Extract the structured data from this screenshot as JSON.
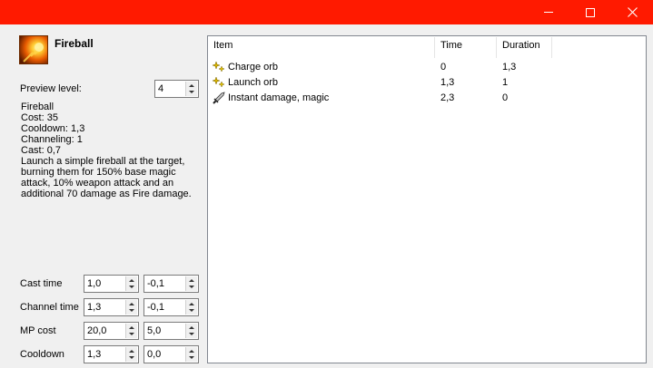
{
  "window": {
    "controls": {
      "minimize": "minimize-icon",
      "maximize": "maximize-icon",
      "close": "close-icon"
    },
    "titlebar_color": "#ff1a00"
  },
  "skill": {
    "name": "Fireball",
    "icon": "fireball-icon"
  },
  "preview": {
    "label": "Preview level:",
    "value": "4"
  },
  "description": {
    "title": "Fireball",
    "cost": "Cost: 35",
    "cooldown": "Cooldown: 1,3",
    "channeling": "Channeling: 1",
    "cast": "Cast: 0,7",
    "text": "Launch a simple fireball at the target, burning them for 150% base magic attack, 10% weapon attack and an additional 70 damage as Fire damage."
  },
  "params": [
    {
      "label": "Cast time",
      "base": "1,0",
      "per_level": "-0,1"
    },
    {
      "label": "Channel time",
      "base": "1,3",
      "per_level": "-0,1"
    },
    {
      "label": "MP cost",
      "base": "20,0",
      "per_level": "5,0"
    },
    {
      "label": "Cooldown",
      "base": "1,3",
      "per_level": "0,0"
    }
  ],
  "list": {
    "columns": [
      "Item",
      "Time",
      "Duration"
    ],
    "rows": [
      {
        "icon": "orb-sparkle-icon",
        "item": "Charge orb",
        "time": "0",
        "duration": "1,3"
      },
      {
        "icon": "orb-sparkle-icon",
        "item": "Launch orb",
        "time": "1,3",
        "duration": "1"
      },
      {
        "icon": "sword-icon",
        "item": "Instant damage, magic",
        "time": "2,3",
        "duration": "0"
      }
    ]
  }
}
